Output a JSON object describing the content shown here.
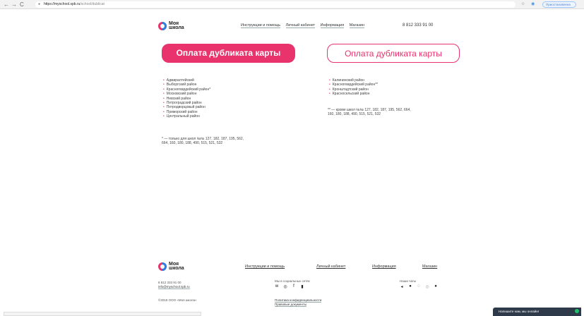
{
  "browser": {
    "back": "←",
    "forward": "→",
    "reload": "C",
    "url_host": "https://myschool.spb.ru",
    "url_path": "/school/dublicat",
    "star": "☆",
    "ext": "◉",
    "account_label": "Приостановлена"
  },
  "logo": {
    "line1": "Моя",
    "line2": "школа"
  },
  "header": {
    "nav": [
      "Инструкции и помощь",
      "Личный кабинет",
      "Информация",
      "Магазин"
    ],
    "phone": "8 812 333 91 00"
  },
  "cards": {
    "left_button": "Оплата дубликата карты",
    "right_button": "Оплата дубликата карты",
    "left_districts": [
      "Адмиралтейский",
      "Выборгский район",
      "Красногвардейский район*",
      "Московский район",
      "Невский район",
      "Петроградский район",
      "Петродворцовый район",
      "Приморский район",
      "Центральный район"
    ],
    "left_note_1": "* — только для школ №№ 127, 182, 187, 195, 562,",
    "left_note_2": "664, 160, 180, 188, 490, 515, 521, 532",
    "right_districts": [
      "Калининский район",
      "Красногвардейский район**",
      "Кронштадтский район",
      "Красносельский район"
    ],
    "right_note_1": "** — кроме школ №№ 127, 182, 187, 195, 562, 664,",
    "right_note_2": "160, 180, 188, 490, 515, 521, 532"
  },
  "footer": {
    "nav": [
      "Инструкции и помощь",
      "Личный кабинет",
      "Информация",
      "Магазин"
    ],
    "phone": "8 812 333 91 00",
    "email": "info@myschool.spb.ru",
    "copyright": "©2018 ООО «Моя школа»",
    "social_title": "Мы в социальных сетях",
    "social_icons": [
      "vk-icon",
      "instagram-icon",
      "facebook-icon",
      "youtube-icon"
    ],
    "chats_title": "Наши чаты",
    "chat_icons": [
      "telegram-icon",
      "viber-icon",
      "whatsapp-icon",
      "skype-icon",
      "messenger-icon"
    ],
    "privacy": "Политика конфиденциальности",
    "legal": "Правовые документы"
  },
  "chat_widget": {
    "text": "Напишите нам, мы онлайн!"
  },
  "colors": {
    "brand_pink": "#e8336d",
    "brand_blue": "#2a7fe0"
  }
}
